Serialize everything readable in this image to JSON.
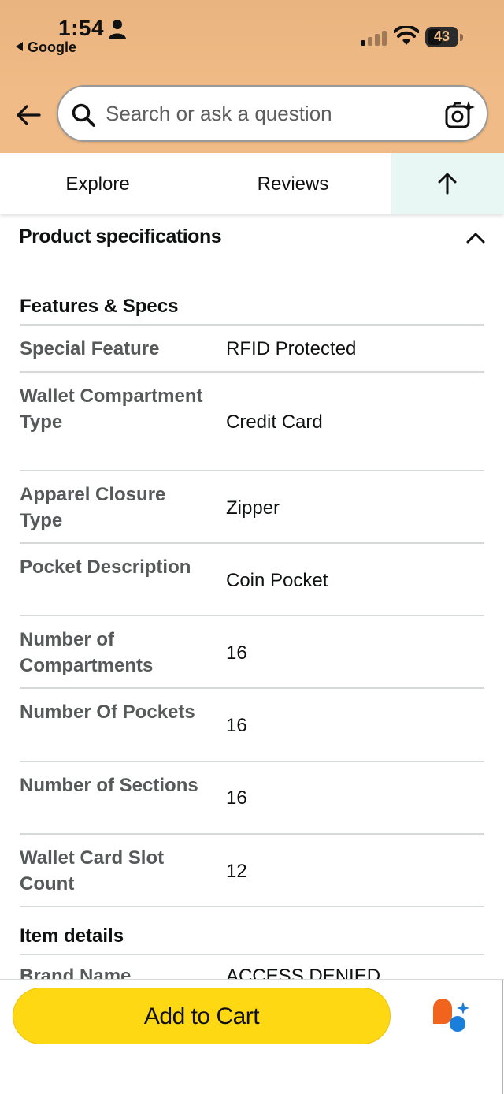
{
  "status_bar": {
    "time": "1:54",
    "back_app": "Google",
    "battery": "43"
  },
  "search": {
    "placeholder": "Search or ask a question"
  },
  "tabs": {
    "explore": "Explore",
    "reviews": "Reviews"
  },
  "section": {
    "title": "Product specifications"
  },
  "features": {
    "title": "Features & Specs",
    "rows": [
      {
        "label": "Special Feature",
        "value": "RFID Protected"
      },
      {
        "label": "Wallet Compartment Type",
        "value": "Credit Card"
      },
      {
        "label": "Apparel Closure Type",
        "value": "Zipper"
      },
      {
        "label": "Pocket Description",
        "value": "Coin Pocket"
      },
      {
        "label": "Number of Compartments",
        "value": "16"
      },
      {
        "label": "Number Of Pockets",
        "value": "16"
      },
      {
        "label": "Number of Sections",
        "value": "16"
      },
      {
        "label": "Wallet Card Slot Count",
        "value": "12"
      }
    ]
  },
  "item_details": {
    "title": "Item details",
    "rows": [
      {
        "label": "Brand Name",
        "value": "ACCESS DENIED"
      }
    ]
  },
  "bottom": {
    "add_to_cart": "Add to Cart"
  },
  "colors": {
    "header_bg": "#f0bb86",
    "cart_button": "#ffd814",
    "up_tab_bg": "#e8f7f3"
  }
}
